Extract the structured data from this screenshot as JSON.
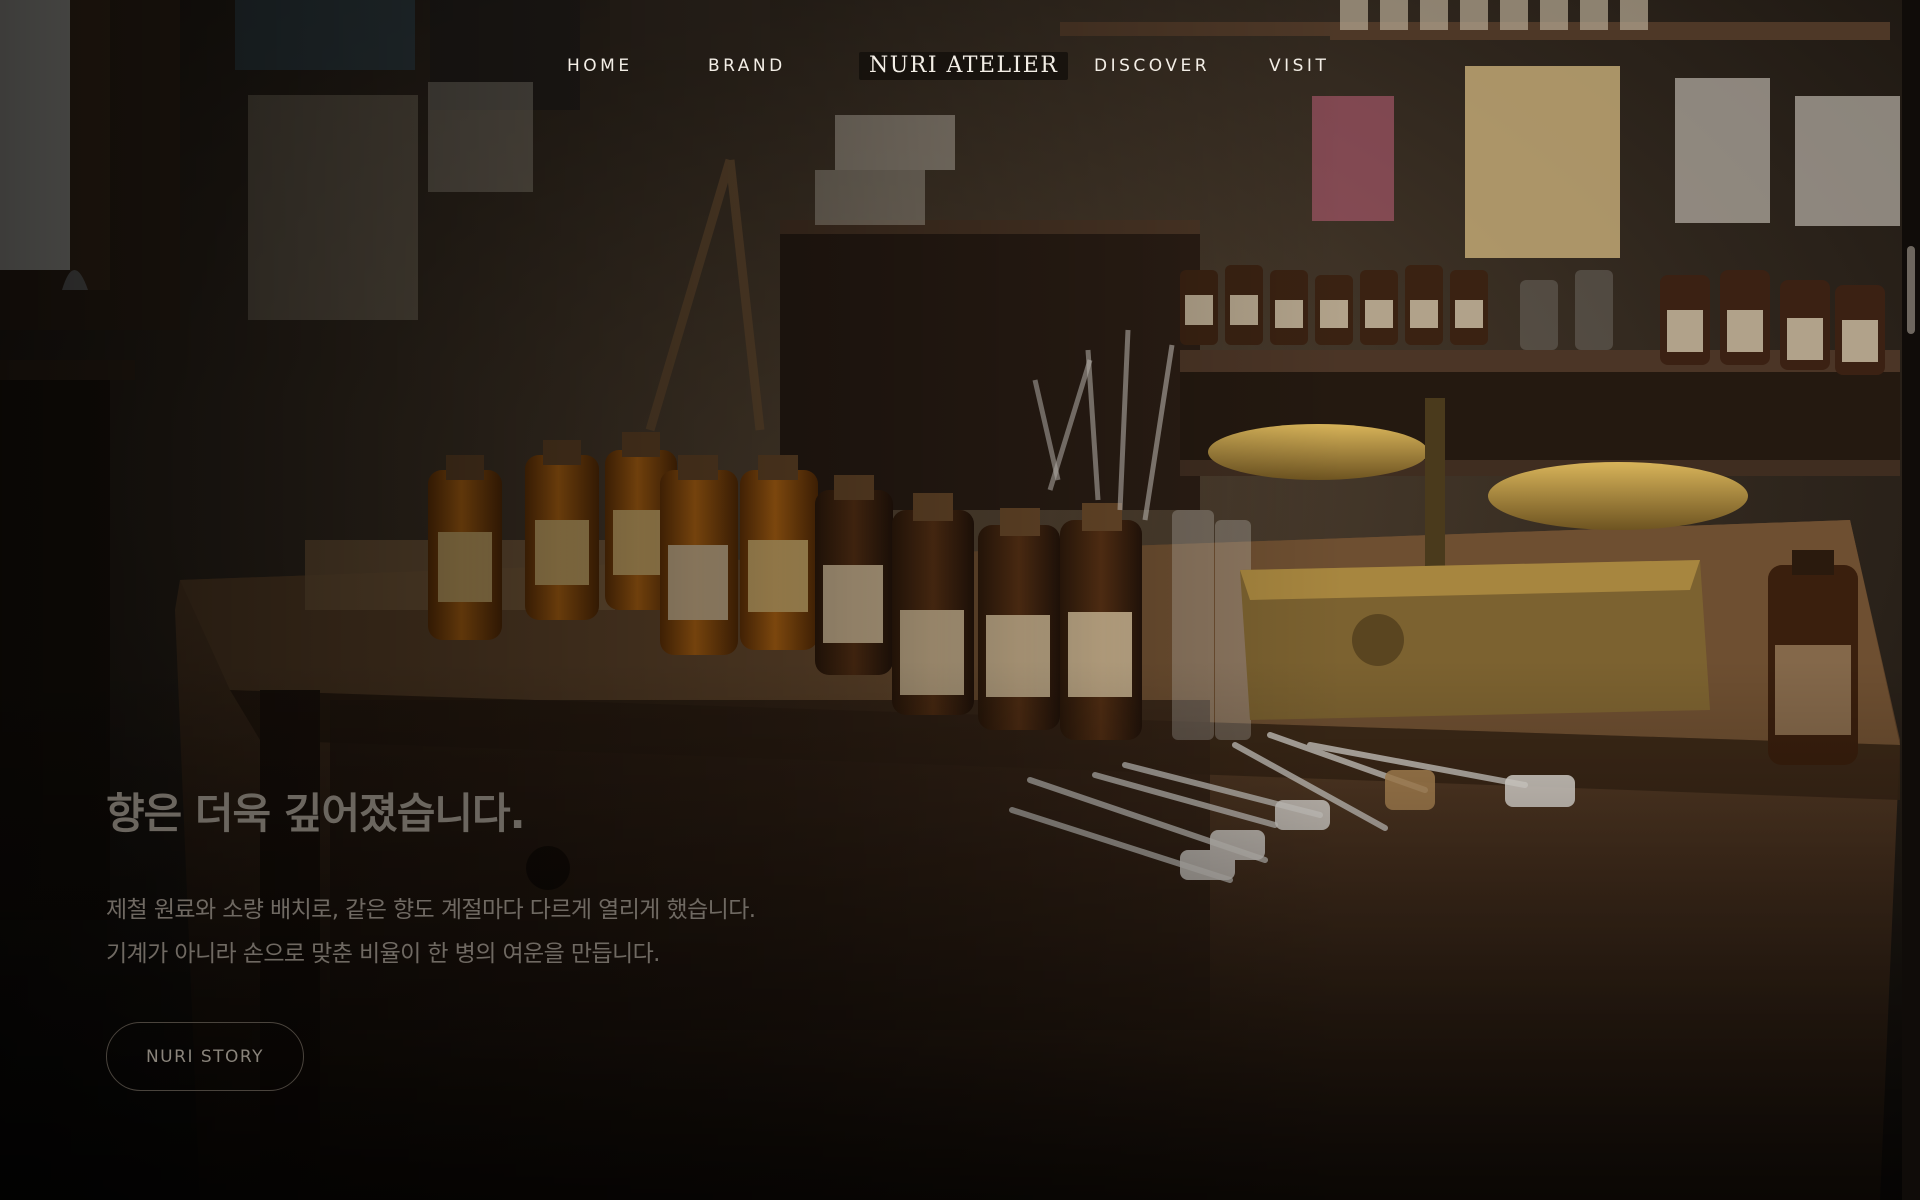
{
  "nav": {
    "home": "HOME",
    "brand": "BRAND",
    "title": "NURI ATELIER",
    "discover": "DISCOVER",
    "visit": "VISIT"
  },
  "hero": {
    "headline": "향은 더욱 깊어졌습니다.",
    "desc_line1": "제철 원료와 소량 배치로, 같은 향도 계절마다 다르게 열리게 했습니다.",
    "desc_line2": "기계가 아니라 손으로 맞춘 비율이 한 병의 여운을 만듭니다.",
    "cta_label": "NURI STORY"
  },
  "colors": {
    "nav_text": "#f3eee6",
    "headline": "#6b665f",
    "body_text": "#6f6962",
    "cta_border": "#4a443d",
    "amber_glass": "#a5570e",
    "label_paper": "#e6c27a",
    "brass": "#b8973e"
  },
  "icons": {
    "scroll": "scroll-thumb"
  }
}
